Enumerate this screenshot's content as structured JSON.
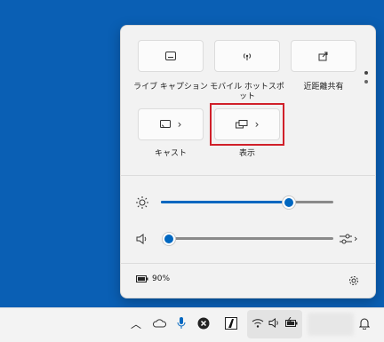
{
  "quick_settings": {
    "tiles": [
      {
        "label": "ライブ キャプション",
        "icon": "captions-icon"
      },
      {
        "label": "モバイル ホットスポット",
        "icon": "hotspot-icon"
      },
      {
        "label": "近距離共有",
        "icon": "nearby-share-icon"
      },
      {
        "label": "キャスト",
        "icon": "cast-icon",
        "chevron": "›"
      },
      {
        "label": "表示",
        "icon": "project-display-icon",
        "chevron": "›"
      }
    ],
    "brightness": {
      "icon": "sun-icon",
      "value": 0.74
    },
    "volume": {
      "icon": "speaker-icon",
      "value": 0.02
    },
    "battery_text": "90%",
    "settings_icon": "gear-icon"
  },
  "taskbar": {
    "icons": [
      "chevron-up-icon",
      "onedrive-cloud-icon",
      "microphone-icon",
      "close-circle-icon",
      "app-a-icon",
      "wifi-icon",
      "speaker-icon",
      "battery-icon",
      "bell-icon"
    ]
  },
  "colors": {
    "accent": "#0067c0",
    "highlight": "#d0202a",
    "desktop": "#0a5fb4"
  }
}
